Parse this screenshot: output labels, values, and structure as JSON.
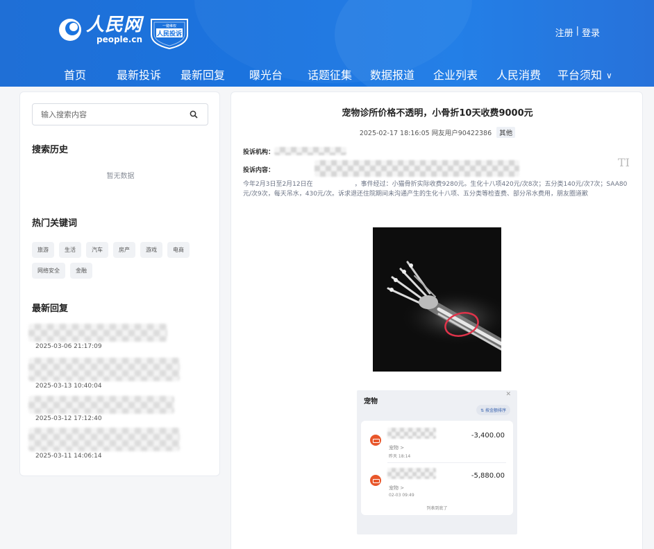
{
  "brand": {
    "name_cn": "人民网",
    "name_en": "people.cn",
    "badge_top": "一键维权",
    "badge_main": "人民投诉"
  },
  "auth": {
    "register": "注册",
    "separator": "|",
    "login": "登录"
  },
  "nav": [
    "首页",
    "最新投诉",
    "最新回复",
    "曝光台",
    "话题征集",
    "数据报道",
    "企业列表",
    "人民消费",
    "平台须知"
  ],
  "sidebar": {
    "search_placeholder": "输入搜索内容",
    "history_title": "搜索历史",
    "history_empty": "暂无数据",
    "hot_title": "热门关键词",
    "hot_tags": [
      "旅游",
      "生活",
      "汽车",
      "房产",
      "游戏",
      "电商",
      "网络安全",
      "金融"
    ],
    "latest_title": "最新回复",
    "latest_replies": [
      {
        "time": "2025-03-06 21:17:09"
      },
      {
        "time": "2025-03-13 10:40:04"
      },
      {
        "time": "2025-03-12 17:12:40"
      },
      {
        "time": "2025-03-11 14:06:14"
      }
    ]
  },
  "complaint": {
    "title": "宠物诊所价格不透明，小骨折10天收费9000元",
    "datetime": "2025-02-17 18:16:05",
    "user": "网友用户90422386",
    "category": "其他",
    "org_label": "投诉机构：",
    "content_label": "投诉内容：",
    "content_start": "今年2月3日至2月12日在",
    "content_rest": "，事件经过：小猫骨折实际收费9280元。生化十八项420元/次8次；五分类140元/次7次；SAA80元/次9次，每天吊水，430元/次。诉求退还住院期间未沟通产生的生化十八项、五分类等检查费、部分吊水费用，朋友圈道歉",
    "watermark": "TI"
  },
  "payment": {
    "title": "宠物",
    "sort_label": "⇅ 按金额排序",
    "rows": [
      {
        "category": "宠物 >",
        "date": "昨天 18:14",
        "amount": "-3,400.00"
      },
      {
        "category": "宠物 >",
        "date": "02-03 09:49",
        "amount": "-5,880.00"
      }
    ],
    "end_text": "列表到底了"
  },
  "colors": {
    "header_blue": "#1a74e0",
    "xray_mark": "#e0334a",
    "pay_icon": "#e8562a"
  }
}
